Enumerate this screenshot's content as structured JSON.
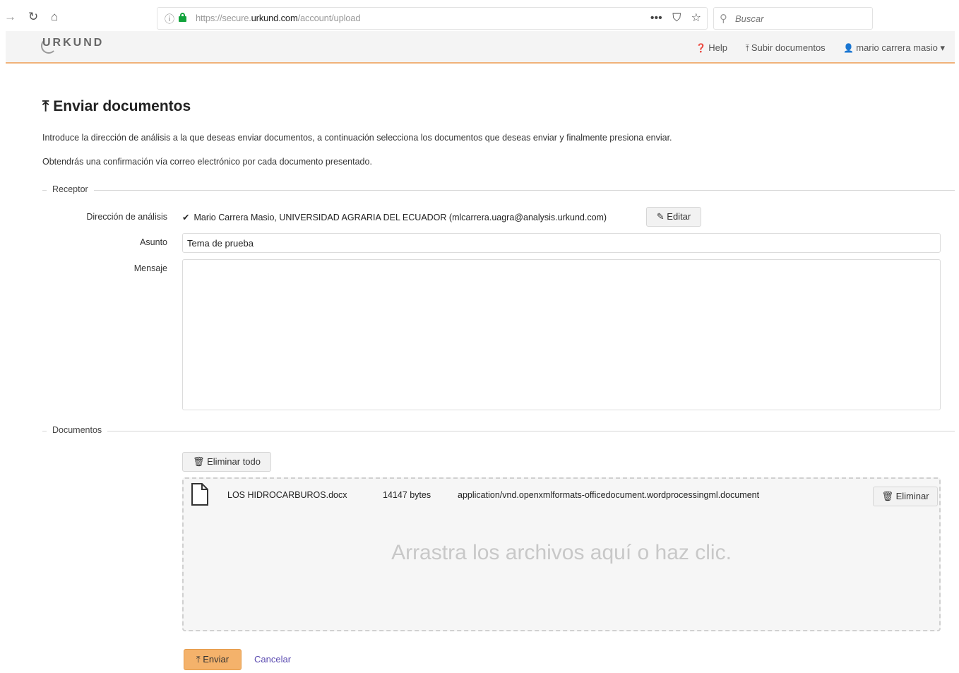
{
  "browser": {
    "url_prefix": "https://secure.",
    "url_host": "urkund.com",
    "url_path": "/account/upload",
    "search_placeholder": "Buscar",
    "icons": [
      "back-icon",
      "reload-icon",
      "home-icon",
      "info-icon",
      "lock-icon",
      "more-icon",
      "pocket-icon",
      "star-icon",
      "search-icon"
    ]
  },
  "navbar": {
    "logo": "URKUND",
    "help": "Help",
    "upload": "Subir documentos",
    "user": "mario carrera masio"
  },
  "page": {
    "title": "Enviar documentos",
    "intro1": "Introduce la dirección de análisis a la que deseas enviar documentos, a continuación selecciona los documentos que deseas enviar y finalmente presiona enviar.",
    "intro2": "Obtendrás una confirmación vía correo electrónico por cada documento presentado."
  },
  "receptor": {
    "legend": "Receptor",
    "address_label": "Dirección de análisis",
    "address_value": "Mario Carrera Masio,  UNIVERSIDAD AGRARIA DEL ECUADOR  (mlcarrera.uagra@analysis.urkund.com)",
    "edit_button": "Editar",
    "subject_label": "Asunto",
    "subject_value": "Tema de prueba",
    "message_label": "Mensaje",
    "message_value": ""
  },
  "documents": {
    "legend": "Documentos",
    "remove_all_button": "Eliminar todo",
    "files": [
      {
        "name": "LOS HIDROCARBUROS.docx",
        "size": "14147  bytes",
        "type": "application/vnd.openxmlformats-officedocument.wordprocessingml.document",
        "remove_button": "Eliminar"
      }
    ],
    "drop_hint": "Arrastra los archivos aquí o haz clic."
  },
  "actions": {
    "send_button": "Enviar",
    "cancel_link": "Cancelar"
  }
}
